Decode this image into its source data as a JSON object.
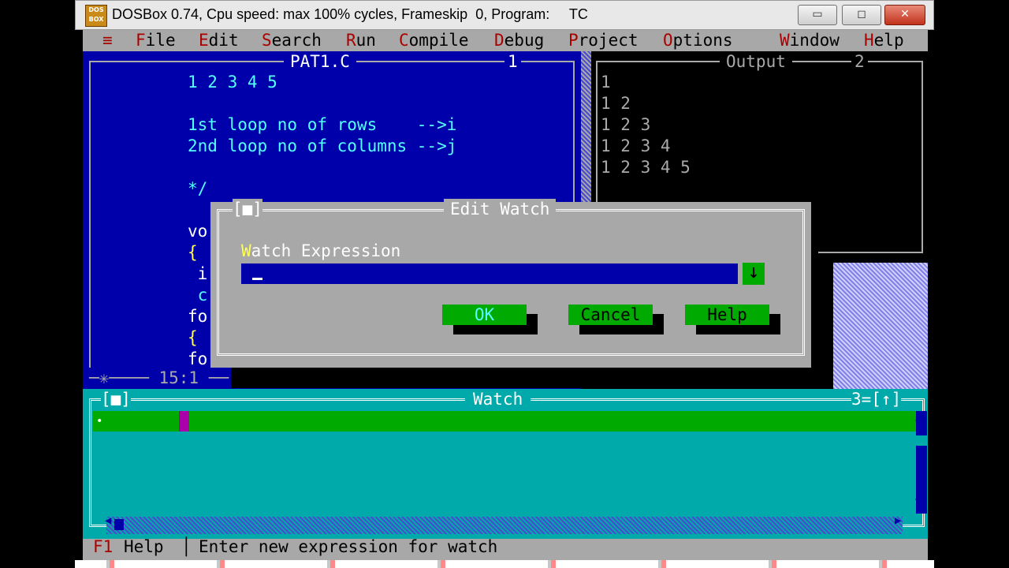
{
  "window": {
    "icon_text": "DOS BOX",
    "title": "DOSBox 0.74, Cpu speed: max 100% cycles, Frameskip  0, Program:     TC",
    "min_symbol": "▭",
    "max_symbol": "◻",
    "close_symbol": "✕"
  },
  "menubar": {
    "system": "≡",
    "items": [
      {
        "hot": "F",
        "rest": "ile"
      },
      {
        "hot": "E",
        "rest": "dit"
      },
      {
        "hot": "S",
        "rest": "earch"
      },
      {
        "hot": "R",
        "rest": "un"
      },
      {
        "hot": "C",
        "rest": "ompile"
      },
      {
        "hot": "D",
        "rest": "ebug"
      },
      {
        "hot": "P",
        "rest": "roject",
        "prefix": ""
      },
      {
        "hot": "O",
        "rest": "ptions"
      },
      {
        "hot": "W",
        "rest": "indow"
      },
      {
        "hot": "H",
        "rest": "elp"
      }
    ]
  },
  "editor": {
    "title": "PAT1.C",
    "window_number": "1",
    "lines": [
      "1 2 3 4 5",
      "",
      "1st loop no of rows    -->i",
      "2nd loop no of columns -->j",
      "",
      "*/"
    ],
    "fragments": [
      "vo",
      "{",
      " i",
      " c",
      "fo",
      "{",
      "fo"
    ],
    "status": "─✳──── 15:1 ──"
  },
  "output": {
    "title": "Output",
    "window_number": "2",
    "lines": [
      "1",
      "1 2",
      "1 2 3",
      "1 2 3 4",
      "1 2 3 4 5"
    ]
  },
  "dialog": {
    "close_box": "[■]",
    "title": "Edit Watch",
    "label_hot": "W",
    "label_rest": "atch Expression",
    "input_value": "",
    "history_arrow": "↓",
    "ok_label": "OK",
    "cancel_label": "Cancel",
    "help_label": "Help"
  },
  "watch_window": {
    "close_box": "[■]",
    "title": "Watch",
    "right_text": "3=[↑]",
    "bullet": "•"
  },
  "statusline": {
    "key": "F1",
    "key_label": "Help",
    "separator": "│",
    "message": "Enter new expression for watch"
  },
  "colors": {
    "editor_bg": "#0000aa",
    "code_text": "#55ffff",
    "watch_bg": "#00aaaa",
    "button_green": "#00aa00",
    "menu_bg": "#a8a8a8",
    "hotkey_red": "#aa0000"
  }
}
